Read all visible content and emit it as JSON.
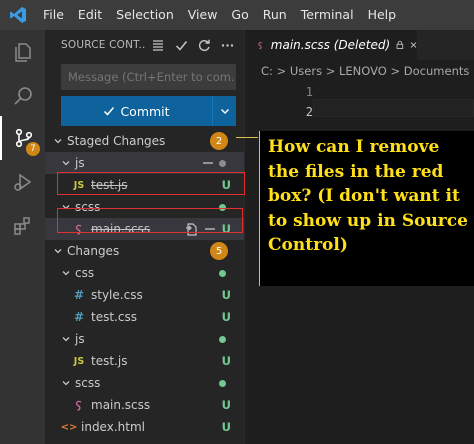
{
  "menu": [
    "File",
    "Edit",
    "Selection",
    "View",
    "Go",
    "Run",
    "Terminal",
    "Help"
  ],
  "activity": {
    "scm_badge": "7"
  },
  "sidebar": {
    "title": "SOURCE CONT...",
    "message_placeholder": "Message (Ctrl+Enter to com...",
    "commit_label": "Commit",
    "staged": {
      "label": "Staged Changes",
      "count": "2",
      "folders": [
        {
          "name": "js",
          "files": [
            {
              "name": "test.js",
              "status": "U"
            }
          ]
        },
        {
          "name": "scss",
          "files": [
            {
              "name": "main.scss",
              "status": "U"
            }
          ]
        }
      ]
    },
    "changes": {
      "label": "Changes",
      "count": "5",
      "folders": [
        {
          "name": "css",
          "files": [
            {
              "name": "style.css",
              "status": "U"
            },
            {
              "name": "test.css",
              "status": "U"
            }
          ]
        },
        {
          "name": "js",
          "files": [
            {
              "name": "test.js",
              "status": "U"
            }
          ]
        },
        {
          "name": "scss",
          "files": [
            {
              "name": "main.scss",
              "status": "U"
            }
          ]
        }
      ],
      "root_files": [
        {
          "name": "index.html",
          "status": "U"
        }
      ]
    }
  },
  "editor": {
    "tab_label": "main.scss (Deleted)",
    "breadcrumb": "C: > Users > LENOVO > Documents > S",
    "line_numbers": [
      "1",
      "2"
    ]
  },
  "annotation": {
    "text": "How can I remove the files in the red box? (I don't want it to show up in Source Control)"
  },
  "colors": {
    "accent": "#0e639c",
    "badge": "#d18616",
    "untracked": "#73c991",
    "annotation_text": "#ffe01a",
    "highlight_box": "#e03030"
  }
}
